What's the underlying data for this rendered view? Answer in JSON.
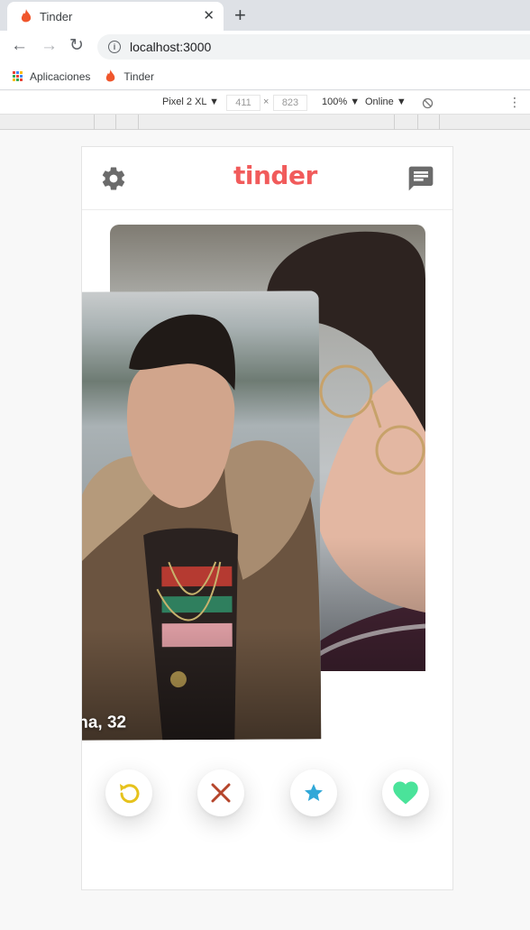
{
  "browser": {
    "tab_title": "Tinder",
    "tab_close": "✕",
    "new_tab": "+",
    "url": "localhost:3000",
    "info_glyph": "i",
    "nav": {
      "back": "←",
      "forward": "→",
      "reload": "↻"
    },
    "bookmarks": [
      {
        "label": "Aplicaciones",
        "icon": "apps-grid-icon"
      },
      {
        "label": "Tinder",
        "icon": "tinder-flame-icon"
      }
    ]
  },
  "devtools": {
    "device": "Pixel 2 XL ▼",
    "width": "411",
    "times": "×",
    "height": "823",
    "zoom": "100% ▼",
    "network": "Online ▼",
    "rotate_icon": "rotate-icon",
    "menu": "⋮"
  },
  "app": {
    "logo": "tinder",
    "settings_icon": "gear-icon",
    "chat_icon": "chat-icon",
    "cards": [
      {
        "name": "na, 32"
      }
    ],
    "actions": [
      {
        "icon": "undo-icon",
        "color": "#f5b748"
      },
      {
        "icon": "close-icon",
        "color": "#b5452b"
      },
      {
        "icon": "star-icon",
        "color": "#31a8d8"
      },
      {
        "icon": "heart-icon",
        "color": "#4ae39a"
      }
    ]
  },
  "colors": {
    "brand": "#f15b5b",
    "chrome_bg": "#dee1e6"
  }
}
